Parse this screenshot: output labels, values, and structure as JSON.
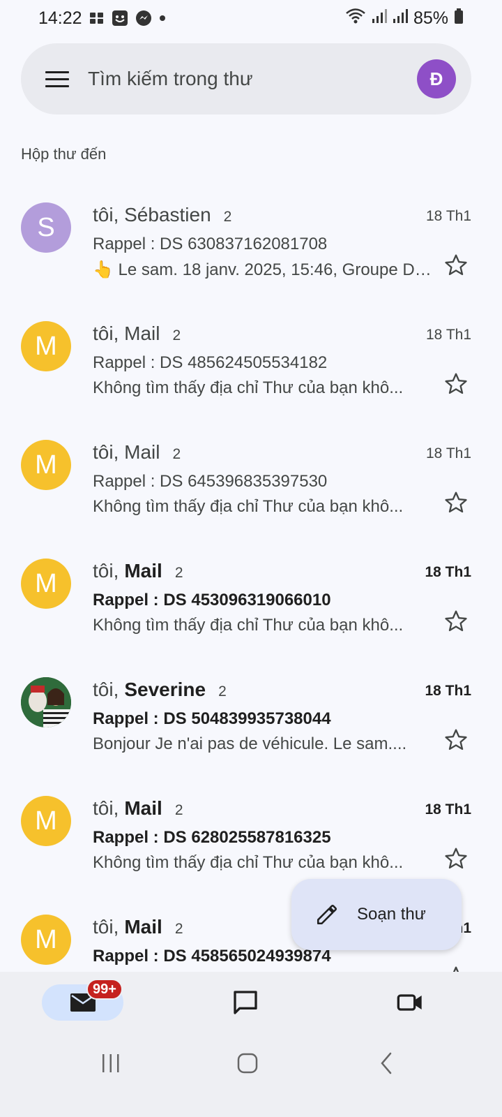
{
  "status": {
    "time": "14:22",
    "battery": "85%"
  },
  "search": {
    "placeholder": "Tìm kiếm trong thư",
    "account_initial": "Đ"
  },
  "section": {
    "label": "Hộp thư đến"
  },
  "emails": [
    {
      "avatar_letter": "S",
      "sender_prefix": "tôi, Sébastien",
      "sender_bold": "",
      "count": "2",
      "date": "18 Th1",
      "subject": "Rappel : DS 630837162081708",
      "snippet": "👆 Le sam. 18 janv. 2025, 15:46, Groupe Dis...",
      "unread": false
    },
    {
      "avatar_letter": "M",
      "sender_prefix": "tôi, Mail",
      "sender_bold": "",
      "count": "2",
      "date": "18 Th1",
      "subject": "Rappel : DS 485624505534182",
      "snippet": "Không tìm thấy địa chỉ Thư của bạn khô...",
      "unread": false
    },
    {
      "avatar_letter": "M",
      "sender_prefix": "tôi, Mail",
      "sender_bold": "",
      "count": "2",
      "date": "18 Th1",
      "subject": "Rappel : DS 645396835397530",
      "snippet": "Không tìm thấy địa chỉ Thư của bạn khô...",
      "unread": false
    },
    {
      "avatar_letter": "M",
      "sender_prefix": "tôi,",
      "sender_bold": "Mail",
      "count": "2",
      "date": "18 Th1",
      "subject": "Rappel : DS 453096319066010",
      "snippet": "Không tìm thấy địa chỉ Thư của bạn khô...",
      "unread": true
    },
    {
      "avatar_letter": "",
      "sender_prefix": "tôi,",
      "sender_bold": "Severine",
      "count": "2",
      "date": "18 Th1",
      "subject": "Rappel : DS 504839935738044",
      "snippet": "Bonjour Je n'ai pas de véhicule. Le sam....",
      "unread": true
    },
    {
      "avatar_letter": "M",
      "sender_prefix": "tôi,",
      "sender_bold": "Mail",
      "count": "2",
      "date": "18 Th1",
      "subject": "Rappel : DS 628025587816325",
      "snippet": "Không tìm thấy địa chỉ Thư của bạn khô...",
      "unread": true
    },
    {
      "avatar_letter": "M",
      "sender_prefix": "tôi,",
      "sender_bold": "Mail",
      "count": "2",
      "date": "18 Th1",
      "subject": "Rappel : DS 458565024939874",
      "snippet": "",
      "unread": true
    }
  ],
  "compose": {
    "label": "Soạn thư"
  },
  "nav": {
    "mail_badge": "99+"
  }
}
